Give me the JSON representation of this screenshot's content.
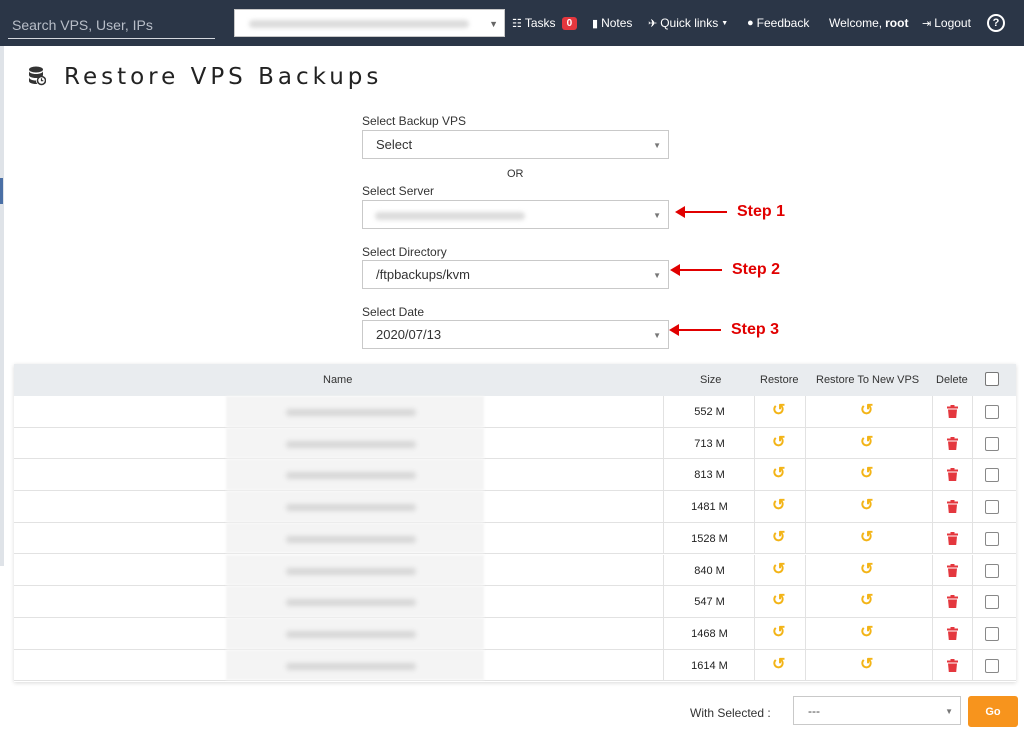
{
  "topbar": {
    "search_placeholder": "Search VPS, User, IPs",
    "tasks_label": "Tasks",
    "tasks_count": "0",
    "notes_label": "Notes",
    "quicklinks_label": "Quick links",
    "feedback_label": "Feedback",
    "welcome_label": "Welcome,",
    "username": "root",
    "logout_label": "Logout"
  },
  "page": {
    "title": "Restore VPS Backups"
  },
  "form": {
    "backup_vps_label": "Select Backup VPS",
    "backup_vps_value": "Select",
    "or_label": "OR",
    "server_label": "Select Server",
    "directory_label": "Select Directory",
    "directory_value": "/ftpbackups/kvm",
    "date_label": "Select Date",
    "date_value": "2020/07/13"
  },
  "annotations": {
    "step1": "Step 1",
    "step2": "Step 2",
    "step3": "Step 3",
    "color": "#e10000"
  },
  "table": {
    "headers": {
      "name": "Name",
      "size": "Size",
      "restore": "Restore",
      "restore_new": "Restore To New VPS",
      "delete": "Delete"
    },
    "rows": [
      {
        "size": "552 M"
      },
      {
        "size": "713 M"
      },
      {
        "size": "813 M"
      },
      {
        "size": "1481 M"
      },
      {
        "size": "1528 M"
      },
      {
        "size": "840 M"
      },
      {
        "size": "547 M"
      },
      {
        "size": "1468 M"
      },
      {
        "size": "1614 M"
      }
    ]
  },
  "footer": {
    "with_selected_label": "With Selected :",
    "with_selected_value": "---",
    "go_label": "Go"
  },
  "colors": {
    "topbar": "#2b3647",
    "restore_icon": "#f3b417",
    "delete_icon": "#e4373e",
    "go_button": "#f7941d"
  }
}
